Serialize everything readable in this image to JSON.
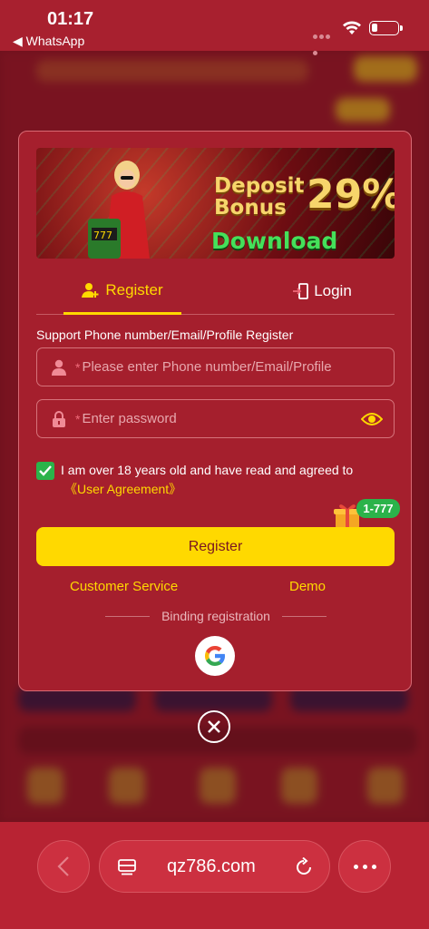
{
  "status_bar": {
    "time": "01:17",
    "back_app": "◀ WhatsApp"
  },
  "modal": {
    "banner": {
      "headline_line1": "Deposit",
      "headline_line2": "Bonus",
      "percent": "29%",
      "cta": "Download Now"
    },
    "tabs": [
      {
        "label": "Register",
        "active": true
      },
      {
        "label": "Login",
        "active": false
      }
    ],
    "support_label": "Support Phone number/Email/Profile Register",
    "username_placeholder": "Please enter Phone number/Email/Profile",
    "password_placeholder": "Enter password",
    "required_mark": "*",
    "agree_text": "I am over 18 years old and have read and agreed to",
    "agreement_link": "《User Agreement》",
    "agreed": true,
    "gift_badge": "1-777",
    "register_button": "Register",
    "customer_service": "Customer Service",
    "demo": "Demo",
    "binding_label": "Binding registration"
  },
  "browser": {
    "url": "qz786.com"
  },
  "colors": {
    "accent": "#ffd900",
    "modal_bg": "#a51f2d",
    "check_green": "#2bb34a"
  }
}
